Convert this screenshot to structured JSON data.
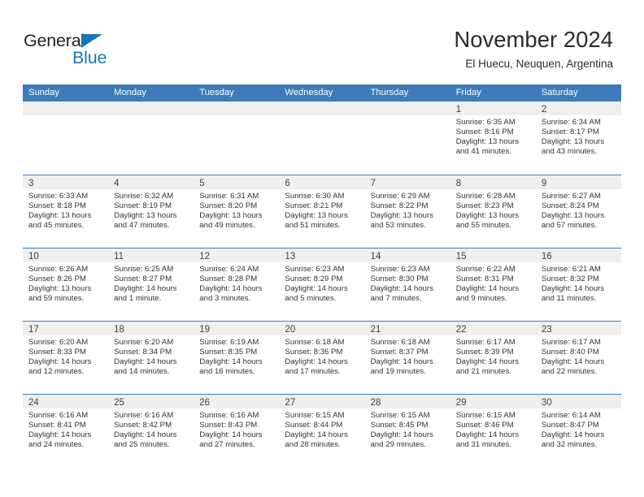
{
  "brand": {
    "word_one": "General",
    "word_two": "Blue",
    "accent_color": "#1b75bb"
  },
  "header": {
    "title": "November 2024",
    "subtitle": "El Huecu, Neuquen, Argentina"
  },
  "theme": {
    "header_blue": "#3d7cb8",
    "day_band_gray": "#efefef"
  },
  "weekdays": [
    "Sunday",
    "Monday",
    "Tuesday",
    "Wednesday",
    "Thursday",
    "Friday",
    "Saturday"
  ],
  "weeks": [
    [
      {
        "day": "",
        "empty": true
      },
      {
        "day": "",
        "empty": true
      },
      {
        "day": "",
        "empty": true
      },
      {
        "day": "",
        "empty": true
      },
      {
        "day": "",
        "empty": true
      },
      {
        "day": "1",
        "sunrise": "Sunrise: 6:35 AM",
        "sunset": "Sunset: 8:16 PM",
        "daylight_1": "Daylight: 13 hours",
        "daylight_2": "and 41 minutes."
      },
      {
        "day": "2",
        "sunrise": "Sunrise: 6:34 AM",
        "sunset": "Sunset: 8:17 PM",
        "daylight_1": "Daylight: 13 hours",
        "daylight_2": "and 43 minutes."
      }
    ],
    [
      {
        "day": "3",
        "sunrise": "Sunrise: 6:33 AM",
        "sunset": "Sunset: 8:18 PM",
        "daylight_1": "Daylight: 13 hours",
        "daylight_2": "and 45 minutes."
      },
      {
        "day": "4",
        "sunrise": "Sunrise: 6:32 AM",
        "sunset": "Sunset: 8:19 PM",
        "daylight_1": "Daylight: 13 hours",
        "daylight_2": "and 47 minutes."
      },
      {
        "day": "5",
        "sunrise": "Sunrise: 6:31 AM",
        "sunset": "Sunset: 8:20 PM",
        "daylight_1": "Daylight: 13 hours",
        "daylight_2": "and 49 minutes."
      },
      {
        "day": "6",
        "sunrise": "Sunrise: 6:30 AM",
        "sunset": "Sunset: 8:21 PM",
        "daylight_1": "Daylight: 13 hours",
        "daylight_2": "and 51 minutes."
      },
      {
        "day": "7",
        "sunrise": "Sunrise: 6:29 AM",
        "sunset": "Sunset: 8:22 PM",
        "daylight_1": "Daylight: 13 hours",
        "daylight_2": "and 53 minutes."
      },
      {
        "day": "8",
        "sunrise": "Sunrise: 6:28 AM",
        "sunset": "Sunset: 8:23 PM",
        "daylight_1": "Daylight: 13 hours",
        "daylight_2": "and 55 minutes."
      },
      {
        "day": "9",
        "sunrise": "Sunrise: 6:27 AM",
        "sunset": "Sunset: 8:24 PM",
        "daylight_1": "Daylight: 13 hours",
        "daylight_2": "and 57 minutes."
      }
    ],
    [
      {
        "day": "10",
        "sunrise": "Sunrise: 6:26 AM",
        "sunset": "Sunset: 8:26 PM",
        "daylight_1": "Daylight: 13 hours",
        "daylight_2": "and 59 minutes."
      },
      {
        "day": "11",
        "sunrise": "Sunrise: 6:25 AM",
        "sunset": "Sunset: 8:27 PM",
        "daylight_1": "Daylight: 14 hours",
        "daylight_2": "and 1 minute."
      },
      {
        "day": "12",
        "sunrise": "Sunrise: 6:24 AM",
        "sunset": "Sunset: 8:28 PM",
        "daylight_1": "Daylight: 14 hours",
        "daylight_2": "and 3 minutes."
      },
      {
        "day": "13",
        "sunrise": "Sunrise: 6:23 AM",
        "sunset": "Sunset: 8:29 PM",
        "daylight_1": "Daylight: 14 hours",
        "daylight_2": "and 5 minutes."
      },
      {
        "day": "14",
        "sunrise": "Sunrise: 6:23 AM",
        "sunset": "Sunset: 8:30 PM",
        "daylight_1": "Daylight: 14 hours",
        "daylight_2": "and 7 minutes."
      },
      {
        "day": "15",
        "sunrise": "Sunrise: 6:22 AM",
        "sunset": "Sunset: 8:31 PM",
        "daylight_1": "Daylight: 14 hours",
        "daylight_2": "and 9 minutes."
      },
      {
        "day": "16",
        "sunrise": "Sunrise: 6:21 AM",
        "sunset": "Sunset: 8:32 PM",
        "daylight_1": "Daylight: 14 hours",
        "daylight_2": "and 11 minutes."
      }
    ],
    [
      {
        "day": "17",
        "sunrise": "Sunrise: 6:20 AM",
        "sunset": "Sunset: 8:33 PM",
        "daylight_1": "Daylight: 14 hours",
        "daylight_2": "and 12 minutes."
      },
      {
        "day": "18",
        "sunrise": "Sunrise: 6:20 AM",
        "sunset": "Sunset: 8:34 PM",
        "daylight_1": "Daylight: 14 hours",
        "daylight_2": "and 14 minutes."
      },
      {
        "day": "19",
        "sunrise": "Sunrise: 6:19 AM",
        "sunset": "Sunset: 8:35 PM",
        "daylight_1": "Daylight: 14 hours",
        "daylight_2": "and 16 minutes."
      },
      {
        "day": "20",
        "sunrise": "Sunrise: 6:18 AM",
        "sunset": "Sunset: 8:36 PM",
        "daylight_1": "Daylight: 14 hours",
        "daylight_2": "and 17 minutes."
      },
      {
        "day": "21",
        "sunrise": "Sunrise: 6:18 AM",
        "sunset": "Sunset: 8:37 PM",
        "daylight_1": "Daylight: 14 hours",
        "daylight_2": "and 19 minutes."
      },
      {
        "day": "22",
        "sunrise": "Sunrise: 6:17 AM",
        "sunset": "Sunset: 8:39 PM",
        "daylight_1": "Daylight: 14 hours",
        "daylight_2": "and 21 minutes."
      },
      {
        "day": "23",
        "sunrise": "Sunrise: 6:17 AM",
        "sunset": "Sunset: 8:40 PM",
        "daylight_1": "Daylight: 14 hours",
        "daylight_2": "and 22 minutes."
      }
    ],
    [
      {
        "day": "24",
        "sunrise": "Sunrise: 6:16 AM",
        "sunset": "Sunset: 8:41 PM",
        "daylight_1": "Daylight: 14 hours",
        "daylight_2": "and 24 minutes."
      },
      {
        "day": "25",
        "sunrise": "Sunrise: 6:16 AM",
        "sunset": "Sunset: 8:42 PM",
        "daylight_1": "Daylight: 14 hours",
        "daylight_2": "and 25 minutes."
      },
      {
        "day": "26",
        "sunrise": "Sunrise: 6:16 AM",
        "sunset": "Sunset: 8:43 PM",
        "daylight_1": "Daylight: 14 hours",
        "daylight_2": "and 27 minutes."
      },
      {
        "day": "27",
        "sunrise": "Sunrise: 6:15 AM",
        "sunset": "Sunset: 8:44 PM",
        "daylight_1": "Daylight: 14 hours",
        "daylight_2": "and 28 minutes."
      },
      {
        "day": "28",
        "sunrise": "Sunrise: 6:15 AM",
        "sunset": "Sunset: 8:45 PM",
        "daylight_1": "Daylight: 14 hours",
        "daylight_2": "and 29 minutes."
      },
      {
        "day": "29",
        "sunrise": "Sunrise: 6:15 AM",
        "sunset": "Sunset: 8:46 PM",
        "daylight_1": "Daylight: 14 hours",
        "daylight_2": "and 31 minutes."
      },
      {
        "day": "30",
        "sunrise": "Sunrise: 6:14 AM",
        "sunset": "Sunset: 8:47 PM",
        "daylight_1": "Daylight: 14 hours",
        "daylight_2": "and 32 minutes."
      }
    ]
  ]
}
